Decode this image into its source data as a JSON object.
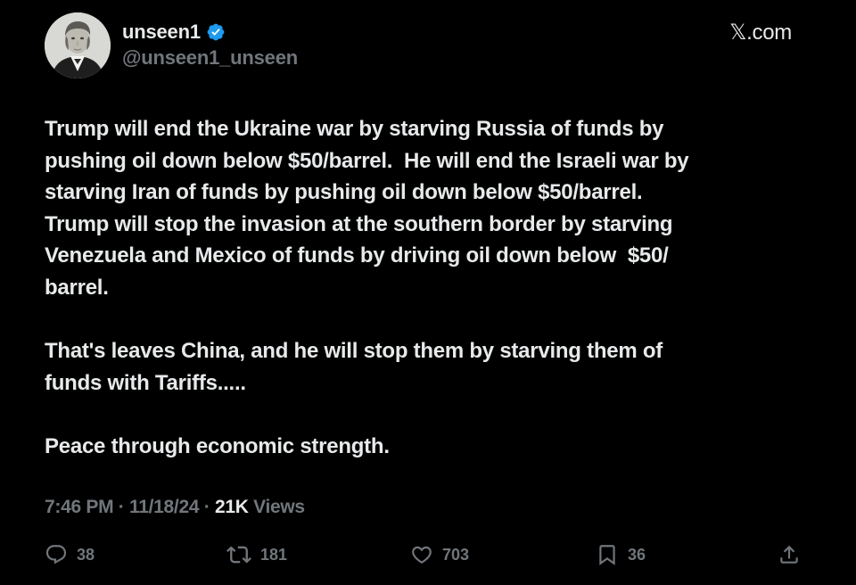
{
  "header": {
    "display_name": "unseen1",
    "handle": "@unseen1_unseen",
    "site": "𝕏.com",
    "verified_color": "#1d9bf0"
  },
  "tweet": {
    "paragraphs": [
      [
        "Trump will end the Ukraine war by starving Russia of funds by",
        "pushing oil down below $50/barrel.  He will end the Israeli war by",
        "starving Iran of funds by pushing oil down below $50/barrel.",
        "Trump will stop the invasion at the southern border by starving",
        "Venezuela and Mexico of funds by driving oil down below  $50/",
        "barrel."
      ],
      [
        "That's leaves China, and he will stop them by starving them of",
        "funds with Tariffs....."
      ],
      [
        "Peace through economic strength."
      ]
    ]
  },
  "meta": {
    "time": "7:46 PM",
    "date": "11/18/24",
    "separator": " · ",
    "views_count": "21K",
    "views_label": " Views"
  },
  "actions": {
    "replies": "38",
    "reposts": "181",
    "likes": "703",
    "bookmarks": "36"
  },
  "icons": {
    "reply": "speech-bubble-icon",
    "repost": "repost-arrows-icon",
    "like": "heart-icon",
    "bookmark": "bookmark-icon",
    "share": "share-upload-icon",
    "verified": "verified-badge-icon"
  },
  "colors": {
    "background": "#000000",
    "text": "#e7e9ea",
    "secondary": "#71767b"
  }
}
